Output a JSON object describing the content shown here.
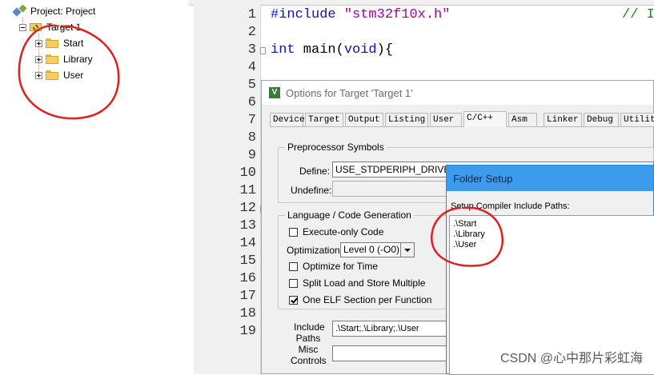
{
  "project_tree": {
    "root": "Project: Project",
    "target": "Target 1",
    "groups": [
      "Start",
      "Library",
      "User"
    ]
  },
  "editor": {
    "line_numbers": [
      "1",
      "2",
      "3",
      "4",
      "5",
      "6",
      "7",
      "8",
      "9",
      "10",
      "11",
      "12",
      "13",
      "14",
      "15",
      "16",
      "17",
      "18",
      "19"
    ],
    "line1": {
      "directive": "#include",
      "header": "\"stm32f10x.h\"",
      "comment": "// I"
    },
    "line3": {
      "type": "int",
      "name": " main(",
      "param": "void",
      "close": "){"
    }
  },
  "options_dialog": {
    "title": "Options for Target 'Target 1'",
    "icon_glyph": "V",
    "tabs": [
      "Device",
      "Target",
      "Output",
      "Listing",
      "User",
      "C/C++",
      "Asm",
      "Linker",
      "Debug",
      "Utiliti"
    ],
    "active_tab": "C/C++",
    "preprocessor": {
      "title": "Preprocessor Symbols",
      "define_label": "Define:",
      "define_value": "USE_STDPERIPH_DRIVER",
      "undefine_label": "Undefine:",
      "undefine_value": ""
    },
    "language": {
      "title": "Language / Code Generation",
      "execute_only": "Execute-only Code",
      "optimization_label": "Optimization:",
      "optimization_value": "Level 0 (-O0)",
      "optimize_time": "Optimize for Time",
      "split_load": "Split Load and Store Multiple",
      "one_elf": "One ELF Section per Function"
    },
    "include_label_1": "Include",
    "include_label_2": "Paths",
    "include_value": ".\\Start;.\\Library;.\\User",
    "misc_label_1": "Misc",
    "misc_label_2": "Controls",
    "misc_value": ""
  },
  "folder_setup": {
    "title": "Folder Setup",
    "label": "Setup Compiler Include Paths:",
    "paths": [
      ".\\Start",
      ".\\Library",
      ".\\User"
    ]
  },
  "watermark": "CSDN @心中那片彩虹海",
  "colors": {
    "annotation": "#e02020",
    "folder_title": "#3c9bec"
  }
}
